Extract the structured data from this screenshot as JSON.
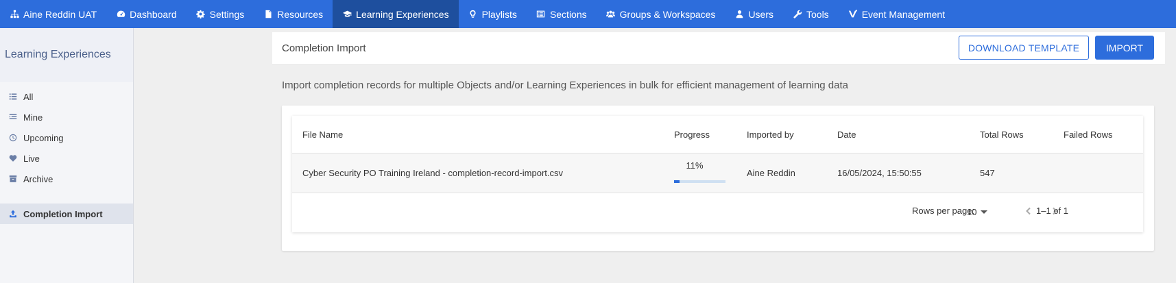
{
  "topnav": {
    "items": [
      {
        "label": "Aine Reddin UAT",
        "icon": "sitemap-icon"
      },
      {
        "label": "Dashboard",
        "icon": "dashboard-icon"
      },
      {
        "label": "Settings",
        "icon": "gear-icon"
      },
      {
        "label": "Resources",
        "icon": "file-icon"
      },
      {
        "label": "Learning Experiences",
        "icon": "graduation-cap-icon",
        "active": true
      },
      {
        "label": "Playlists",
        "icon": "lightbulb-icon"
      },
      {
        "label": "Sections",
        "icon": "list-alt-icon"
      },
      {
        "label": "Groups & Workspaces",
        "icon": "users-icon"
      },
      {
        "label": "Users",
        "icon": "user-icon"
      },
      {
        "label": "Tools",
        "icon": "wrench-icon"
      },
      {
        "label": "Event Management",
        "icon": "v-logo-icon"
      }
    ],
    "bg_color": "#2d6ddc",
    "active_color": "#1e4f9e"
  },
  "sidebar": {
    "title": "Learning Experiences",
    "items": [
      {
        "label": "All",
        "icon": "list-icon"
      },
      {
        "label": "Mine",
        "icon": "list-user-icon"
      },
      {
        "label": "Upcoming",
        "icon": "clock-icon"
      },
      {
        "label": "Live",
        "icon": "heartbeat-icon"
      },
      {
        "label": "Archive",
        "icon": "archive-icon"
      }
    ],
    "secondary_items": [
      {
        "label": "Completion Import",
        "icon": "upload-icon",
        "active": true
      }
    ]
  },
  "header": {
    "title": "Completion Import",
    "download_label": "DOWNLOAD TEMPLATE",
    "import_label": "IMPORT"
  },
  "description": "Import completion records for multiple Objects and/or Learning Experiences in bulk for efficient management of learning data",
  "table": {
    "columns": [
      "File Name",
      "Progress",
      "Imported by",
      "Date",
      "Total Rows",
      "Failed Rows"
    ],
    "rows": [
      {
        "file_name": "Cyber Security PO Training Ireland - completion-record-import.csv",
        "progress": "11%",
        "progress_value": 0.11,
        "imported_by": "Aine Reddin",
        "date": "16/05/2024, 15:50:55",
        "total_rows": "547",
        "failed_rows": ""
      }
    ],
    "footer": {
      "rows_per_page_label": "Rows per page:",
      "rows_per_page_value": "10",
      "page_info": "1–1 of 1"
    }
  }
}
